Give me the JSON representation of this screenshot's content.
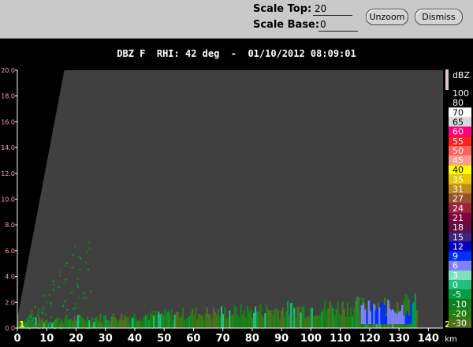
{
  "controls": {
    "scale_top_label": "Scale Top:",
    "scale_top_value": "20",
    "scale_base_label": "Scale Base:",
    "scale_base_value": "0",
    "unzoom_label": "Unzoom",
    "dismiss_label": "Dismiss"
  },
  "plot_title": "DBZ F  RHI: 42 deg  -  01/10/2012 08:09:01",
  "corner_markers": {
    "left": "1",
    "right": "2"
  },
  "colors": {
    "background": "#000000",
    "no_data": "#404040",
    "axis_tick_label": "#ffffff",
    "y_tick_label": "#ff9cc8"
  },
  "chart_data": {
    "type": "heatmap",
    "title": "DBZ F  RHI: 42 deg  -  01/10/2012 08:09:01",
    "x_axis": {
      "unit": "km",
      "range": [
        0,
        145
      ],
      "ticks": [
        0,
        10,
        20,
        30,
        40,
        50,
        60,
        70,
        80,
        90,
        100,
        110,
        120,
        130,
        140
      ],
      "tick_labels": [
        "0",
        "10",
        "20",
        "30",
        "40",
        "50",
        "60",
        "70",
        "80",
        "90",
        "100",
        "110",
        "120",
        "130",
        "140"
      ]
    },
    "y_axis": {
      "range": [
        0,
        20
      ],
      "ticks": [
        0,
        2,
        4,
        6,
        8,
        10,
        12,
        14,
        16,
        18,
        20
      ],
      "tick_labels": [
        "0.0",
        "2.0",
        "4.0",
        "6.0",
        "8.0",
        "10.0",
        "12.0",
        "14.0",
        "16.0",
        "18.0",
        "20.0"
      ]
    },
    "scan_upper_edge": [
      [
        0,
        0.8
      ],
      [
        16,
        20
      ]
    ],
    "colorbar": {
      "title": "dBZ",
      "entries": [
        {
          "label": "100",
          "color": "#000000"
        },
        {
          "label": "80",
          "color": "#000000"
        },
        {
          "label": "70",
          "color": "#ffffff"
        },
        {
          "label": "65",
          "color": "#d8d8d8"
        },
        {
          "label": "60",
          "color": "#ff0080"
        },
        {
          "label": "55",
          "color": "#ff2020"
        },
        {
          "label": "50",
          "color": "#ff6060"
        },
        {
          "label": "45",
          "color": "#ff9a90"
        },
        {
          "label": "40",
          "color": "#ffff00"
        },
        {
          "label": "35",
          "color": "#e8c800"
        },
        {
          "label": "31",
          "color": "#c08a20"
        },
        {
          "label": "27",
          "color": "#9a5030"
        },
        {
          "label": "24",
          "color": "#a02040"
        },
        {
          "label": "21",
          "color": "#800040"
        },
        {
          "label": "18",
          "color": "#601040"
        },
        {
          "label": "15",
          "color": "#402080"
        },
        {
          "label": "12",
          "color": "#0000c0"
        },
        {
          "label": "9",
          "color": "#0030ff"
        },
        {
          "label": "6",
          "color": "#8080ff"
        },
        {
          "label": "3",
          "color": "#80e0c0"
        },
        {
          "label": "0",
          "color": "#20c080"
        },
        {
          "label": "-5",
          "color": "#00a040"
        },
        {
          "label": "-10",
          "color": "#108020"
        },
        {
          "label": "-20",
          "color": "#208010"
        },
        {
          "label": "-30",
          "color": "#507020"
        }
      ]
    },
    "echo_regions": [
      {
        "name": "low-level echo band",
        "x_range": [
          0,
          136
        ],
        "top_height_at_start": 0.8,
        "top_height_at_end": 2.8,
        "dominant_dbz": [
          -30,
          3
        ]
      },
      {
        "name": "stronger echo patch",
        "x_range": [
          117,
          134
        ],
        "top_height": 2.2,
        "dominant_dbz": [
          6,
          12
        ]
      },
      {
        "name": "near-radar scattered echoes",
        "x_range": [
          3,
          25
        ],
        "top_height": 6.8,
        "dominant_dbz": [
          -20,
          0
        ]
      }
    ]
  }
}
